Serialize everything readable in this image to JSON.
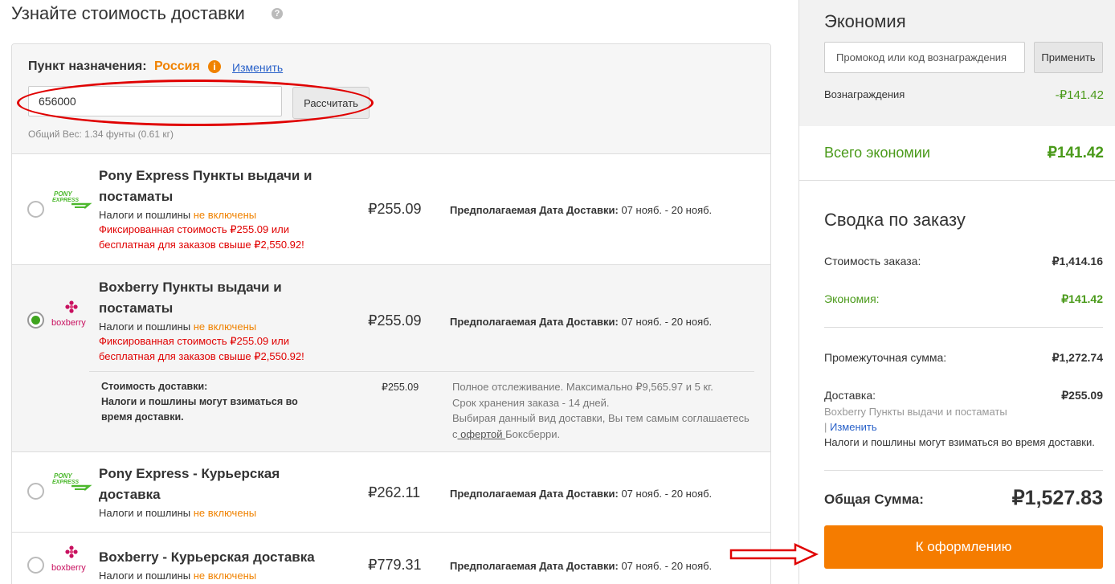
{
  "page": {
    "title": "Узнайте стоимость доставки",
    "help_icon": "?"
  },
  "destination": {
    "label": "Пункт назначения:",
    "country": "Россия",
    "info_icon": "i",
    "change_link": "Изменить",
    "zip_value": "656000",
    "calculate_button": "Рассчитать",
    "weight_text": "Общий Вес: 1.34 фунты (0.61 кг)"
  },
  "options": [
    {
      "logo": "pony-express",
      "name": "Pony Express Пункты выдачи и постаматы",
      "tax_prefix": "Налоги и пошлины ",
      "tax_status": "не включены",
      "promo": "Фиксированная стоимость ₽255.09 или бесплатная для заказов свыше ₽2,550.92!",
      "price": "₽255.09",
      "date_label": "Предполагаемая Дата Доставки:",
      "date_value": " 07 нояб. - 20 нояб.",
      "selected": false
    },
    {
      "logo": "boxberry",
      "name": "Boxberry Пункты выдачи и постаматы",
      "tax_prefix": "Налоги и пошлины ",
      "tax_status": "не включены",
      "promo": "Фиксированная стоимость ₽255.09 или бесплатная для заказов свыше ₽2,550.92!",
      "price": "₽255.09",
      "date_label": "Предполагаемая Дата Доставки:",
      "date_value": " 07 нояб. - 20 нояб.",
      "selected": true,
      "details": {
        "cost_label": "Стоимость доставки:",
        "tax_note": "Налоги и пошлины могут взиматься во время доставки.",
        "cost_value": "₽255.09",
        "info_line1": "Полное отслеживание. Максимально ₽9,565.97 и 5 кг.",
        "info_line2": "Срок хранения заказа - 14 дней.",
        "info_line3": "Выбирая данный вид доставки, Вы тем самым соглашаетесь с",
        "offer_link": " офертой ",
        "info_line3_end": "Боксберри."
      }
    },
    {
      "logo": "pony-express",
      "name": "Pony Express - Курьерская доставка",
      "tax_prefix": "Налоги и пошлины ",
      "tax_status": "не включены",
      "price": "₽262.11",
      "date_label": "Предполагаемая Дата Доставки:",
      "date_value": " 07 нояб. - 20 нояб.",
      "selected": false
    },
    {
      "logo": "boxberry",
      "name": "Boxberry - Курьерская доставка",
      "tax_prefix": "Налоги и пошлины ",
      "tax_status": "не включены",
      "price": "₽779.31",
      "date_label": "Предполагаемая Дата Доставки:",
      "date_value": " 07 нояб. - 20 нояб.",
      "selected": false
    }
  ],
  "logos": {
    "pony_line1": "PONY",
    "pony_line2": "EXPRESS",
    "boxberry_text": "boxberry"
  },
  "savings": {
    "title": "Экономия",
    "promo_placeholder": "Промокод или код вознаграждения",
    "apply_button": "Применить",
    "rewards_label": "Вознаграждения",
    "rewards_value": "-₽141.42",
    "total_label": "Всего экономии",
    "total_value": "₽141.42"
  },
  "summary": {
    "title": "Сводка по заказу",
    "order_cost_label": "Стоимость заказа:",
    "order_cost_value": "₽1,414.16",
    "savings_label": "Экономия:",
    "savings_value": "₽141.42",
    "subtotal_label": "Промежуточная сумма:",
    "subtotal_value": "₽1,272.74",
    "shipping_label": "Доставка:",
    "shipping_value": "₽255.09",
    "shipping_method": "Boxberry Пункты выдачи и постаматы",
    "shipping_change_prefix": "| ",
    "shipping_change_link": "Изменить",
    "shipping_note": "Налоги и пошлины могут взиматься во время доставки.",
    "grand_total_label": "Общая Сумма:",
    "grand_total_value": "₽1,527.83",
    "checkout_button": "К оформлению"
  },
  "colors": {
    "accent_orange": "#f57c00",
    "savings_green": "#4a9a1a",
    "promo_red": "#e00000",
    "link_blue": "#2a62c9",
    "pony_green": "#4cb82d",
    "boxberry_pink": "#c8105f"
  }
}
